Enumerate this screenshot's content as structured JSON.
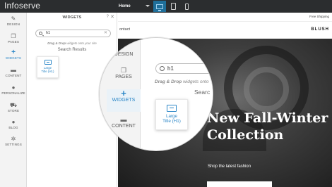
{
  "app": {
    "logo": "Infoserve"
  },
  "topbar": {
    "page_select": "Home",
    "devices": [
      {
        "icon": "desktop-icon",
        "active": true
      },
      {
        "icon": "tablet-icon",
        "active": false
      },
      {
        "icon": "phone-icon",
        "active": false
      }
    ]
  },
  "leftnav": {
    "items": [
      {
        "label": "DESIGN",
        "icon": "pencil-icon",
        "glyph": "✎"
      },
      {
        "label": "PAGES",
        "icon": "pages-icon",
        "glyph": "❐"
      },
      {
        "label": "WIDGETS",
        "icon": "plus-icon",
        "glyph": "+",
        "active": true
      },
      {
        "label": "CONTENT",
        "icon": "folder-icon",
        "glyph": "▬"
      },
      {
        "label": "PERSONALIZE",
        "icon": "person-icon",
        "glyph": "●"
      },
      {
        "label": "STORE",
        "icon": "cart-icon",
        "glyph": "⛟"
      },
      {
        "label": "BLOG",
        "icon": "chat-icon",
        "glyph": "●"
      },
      {
        "label": "SETTINGS",
        "icon": "gear-icon",
        "glyph": "✲"
      }
    ]
  },
  "panel": {
    "title": "WIDGETS",
    "help": "?",
    "close": "✕",
    "search_value": "h1",
    "hint_bold": "Drag & Drop",
    "hint_rest": "widgets onto your site",
    "results_title": "Search Results",
    "result_widget": {
      "line1": "Large",
      "line2": "Title (H1)"
    }
  },
  "site": {
    "top_text": "Free Shipping",
    "contact": "ontact",
    "brand": "BLUSH",
    "hero_title_line1": "New Fall-Winter",
    "hero_title_line2": "Collection",
    "hero_subtitle": "Shop the latest fashion"
  },
  "magnifier": {
    "nav": {
      "design": "DESIGN",
      "pages": "PAGES",
      "widgets": "WIDGETS",
      "content": "CONTENT"
    },
    "search_value": "h1",
    "hint_bold": "Drag & Drop",
    "hint_rest": "widgets onto",
    "results_title": "Searc",
    "card_line1": "Large",
    "card_line2": "Title (H1)"
  },
  "colors": {
    "accent": "#2a86c7",
    "topbar": "#2b2d2f",
    "active_device": "#1f6f9a"
  }
}
